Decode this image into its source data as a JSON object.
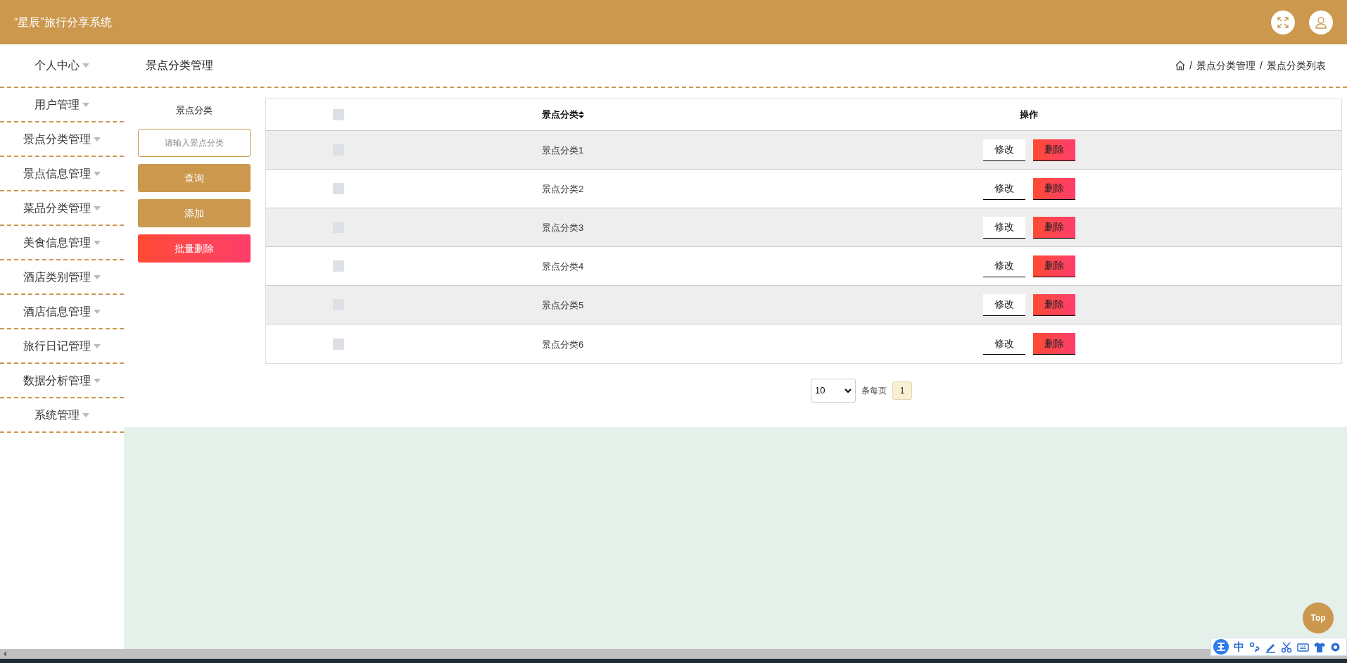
{
  "header": {
    "title": "“星辰”旅行分享系统"
  },
  "sidebar": {
    "items": [
      {
        "label": "个人中心",
        "expanded": false
      },
      {
        "label": "用户管理",
        "expanded": false
      },
      {
        "label": "景点分类管理",
        "expanded": false
      },
      {
        "label": "景点信息管理",
        "expanded": false
      },
      {
        "label": "菜品分类管理",
        "expanded": false
      },
      {
        "label": "美食信息管理",
        "expanded": false
      },
      {
        "label": "酒店类别管理",
        "expanded": false
      },
      {
        "label": "酒店信息管理",
        "expanded": false
      },
      {
        "label": "旅行日记管理",
        "expanded": false
      },
      {
        "label": "数据分析管理",
        "expanded": false
      },
      {
        "label": "系统管理",
        "expanded": false
      }
    ]
  },
  "page_title": "景点分类管理",
  "breadcrumb": {
    "separator": "/",
    "items": [
      "景点分类管理",
      "景点分类列表"
    ]
  },
  "search": {
    "label": "景点分类",
    "placeholder": "请输入景点分类"
  },
  "actions": [
    {
      "label": "查询",
      "kind": "primary"
    },
    {
      "label": "添加",
      "kind": "primary"
    },
    {
      "label": "批量删除",
      "kind": "danger"
    }
  ],
  "table": {
    "select_all_checked": false,
    "columns": [
      "景点分类",
      "操作"
    ],
    "rows": [
      {
        "checked": false,
        "name": "景点分类1",
        "buttons": [
          "修改",
          "删除"
        ]
      },
      {
        "checked": false,
        "name": "景点分类2",
        "buttons": [
          "修改",
          "删除"
        ]
      },
      {
        "checked": false,
        "name": "景点分类3",
        "buttons": [
          "修改",
          "删除"
        ]
      },
      {
        "checked": false,
        "name": "景点分类4",
        "buttons": [
          "修改",
          "删除"
        ]
      },
      {
        "checked": false,
        "name": "景点分类5",
        "buttons": [
          "修改",
          "删除"
        ]
      },
      {
        "checked": false,
        "name": "景点分类6",
        "buttons": [
          "修改",
          "删除"
        ]
      }
    ]
  },
  "pagination": {
    "page_size": "10",
    "per_page_label": "条每页",
    "pages": [
      {
        "label": "1",
        "selected": true
      }
    ]
  },
  "top_button": "Top",
  "ime_toolbar": {
    "mode": "中"
  }
}
